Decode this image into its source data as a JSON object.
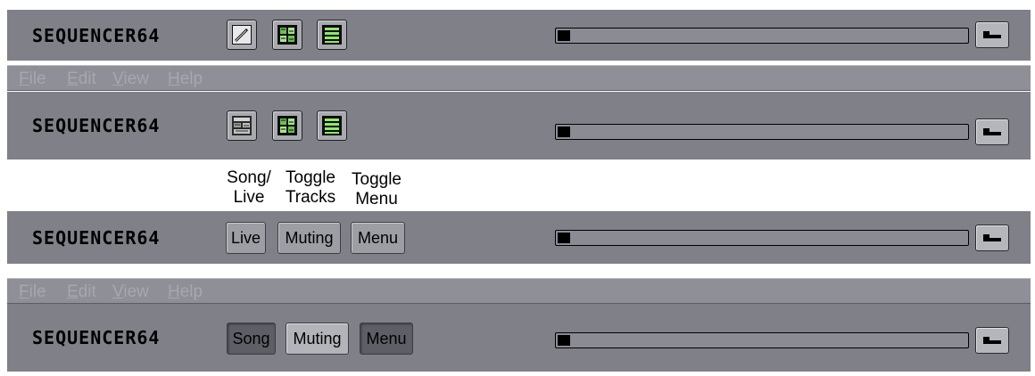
{
  "app": {
    "logo_text": "SEQUENCER64"
  },
  "menu": {
    "items": [
      "File",
      "Edit",
      "View",
      "Help"
    ]
  },
  "captions": {
    "song_live": [
      "Song/",
      "Live"
    ],
    "toggle_tracks": [
      "Toggle",
      "Tracks"
    ],
    "toggle_menu": [
      "Toggle",
      "Menu"
    ]
  },
  "bar3": {
    "live_label": "Live",
    "muting_label": "Muting",
    "menu_label": "Menu"
  },
  "bar4": {
    "song_label": "Song",
    "muting_label": "Muting",
    "menu_label": "Menu"
  },
  "progress": {
    "fraction": 0.03
  },
  "colors": {
    "toolbar_bg": "#7f8088",
    "menubar_bg": "#8e8f97",
    "icon_green": "#8ee86c"
  },
  "icons": {
    "edit": "pencil-icon",
    "song_live": "song-grid-icon",
    "toggle_tracks": "tracks-grid-icon",
    "toggle_menu": "menu-lines-icon",
    "pause": "pause-stop-icon"
  }
}
